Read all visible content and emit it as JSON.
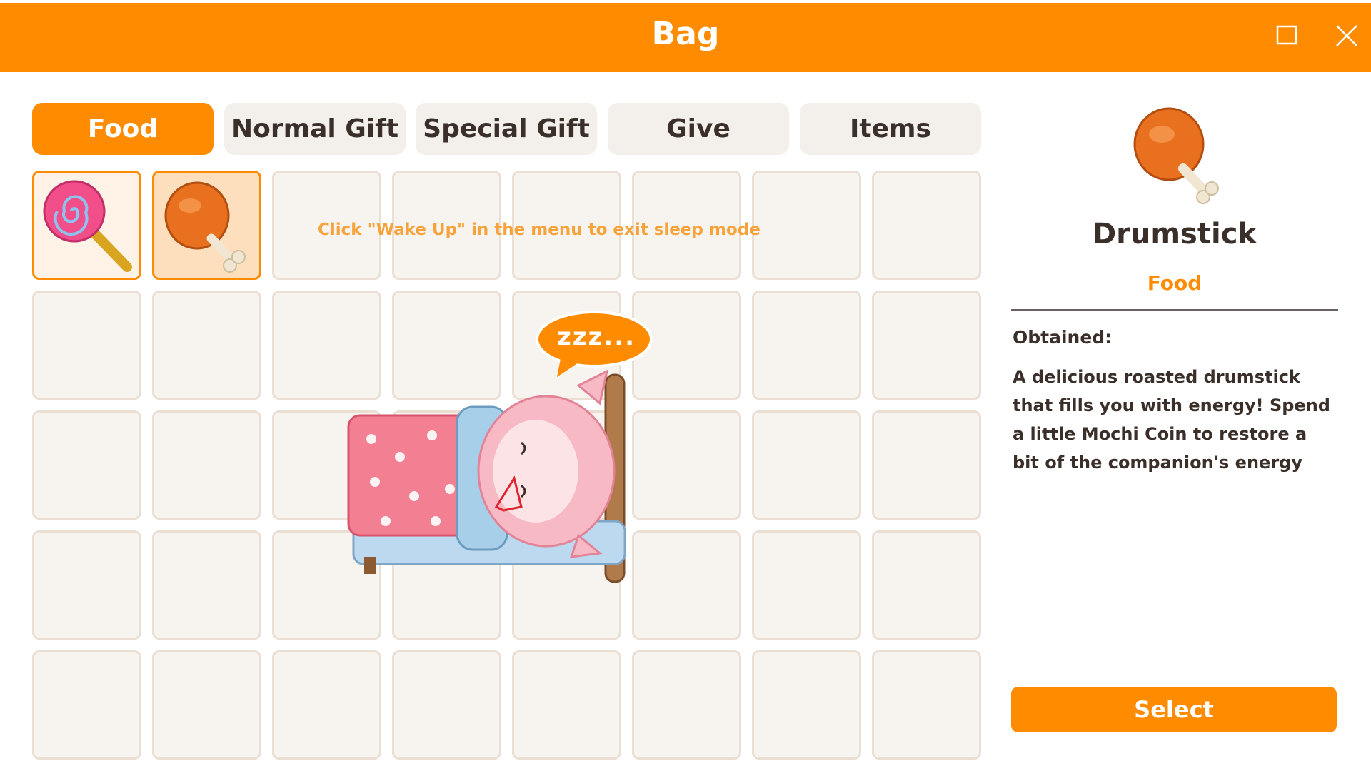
{
  "window": {
    "title": "Bag",
    "controls": [
      "maximize-icon",
      "close-icon"
    ],
    "accent_color": "#FF8C00"
  },
  "tabs": [
    {
      "label": "Food",
      "active": true
    },
    {
      "label": "Normal Gift",
      "active": false
    },
    {
      "label": "Special Gift",
      "active": false
    },
    {
      "label": "Give",
      "active": false
    },
    {
      "label": "Items",
      "active": false
    }
  ],
  "inventory": {
    "slots_per_row": 8,
    "rows": 5,
    "items": [
      {
        "icon": "lollipop-icon",
        "selected": false
      },
      {
        "icon": "drumstick-icon",
        "selected": true
      }
    ]
  },
  "overlay": {
    "sleep_hint": "Click \"Wake Up\" in the menu to exit sleep mode",
    "speech_bubble": "zzz..."
  },
  "detail": {
    "icon": "drumstick-icon",
    "name": "Drumstick",
    "category": "Food",
    "obtained_label": "Obtained:",
    "description": "A delicious roasted drumstick that fills you with energy! Spend a little Mochi Coin to restore a bit of the companion's energy",
    "select_label": "Select"
  }
}
